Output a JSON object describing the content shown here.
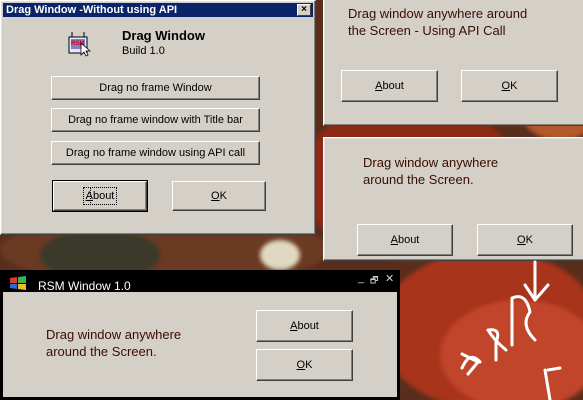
{
  "about_window": {
    "title": "Drag Window -Without using API",
    "close_glyph": "×",
    "app_name": "Drag Window",
    "build": "Build 1.0",
    "logo_text": "RSM",
    "buttons": [
      "Drag no frame Window",
      "Drag no frame window with Title bar",
      "Drag no frame window using API call"
    ],
    "about_label_prefix": "",
    "about_label_accel": "A",
    "about_label_rest": "bout",
    "ok_label_accel": "O",
    "ok_label_rest": "K"
  },
  "api_window": {
    "message_line1": "Drag window anywhere around",
    "message_line2": "the Screen - Using API Call",
    "about_accel": "A",
    "about_rest": "bout",
    "ok_accel": "O",
    "ok_rest": "K"
  },
  "noframe_window": {
    "message_line1": "Drag window anywhere",
    "message_line2": "around the Screen.",
    "about_accel": "A",
    "about_rest": "bout",
    "ok_accel": "O",
    "ok_rest": "K"
  },
  "rsm_window": {
    "title": "RSM Window 1.0",
    "min_glyph": "_",
    "max_glyph": "🗗",
    "close_glyph": "✕",
    "message_line1": "Drag window anywhere",
    "message_line2": "around the Screen.",
    "about_accel": "A",
    "about_rest": "bout",
    "ok_accel": "O",
    "ok_rest": "K"
  },
  "colors": {
    "titlebar": "#0a246a",
    "window_face": "#d4d0c8",
    "message_text": "#3a0d00"
  }
}
